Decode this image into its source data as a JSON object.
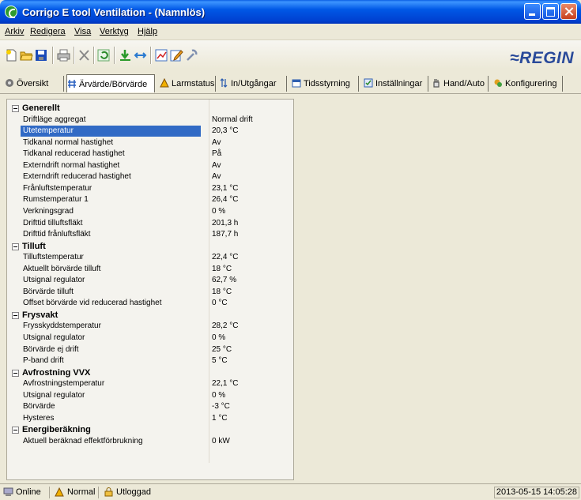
{
  "window": {
    "title": "Corrigo E tool Ventilation - (Namnlös)"
  },
  "menu": [
    "Arkiv",
    "Redigera",
    "Visa",
    "Verktyg",
    "Hjälp"
  ],
  "brand": {
    "logo_text": "≈REGIN",
    "color": "#2a4a9a"
  },
  "tabs": [
    {
      "label": "Översikt",
      "icon": "overview-icon"
    },
    {
      "label": "Ärvärde/Börvärde",
      "icon": "setpoint-icon",
      "active": true
    },
    {
      "label": "Larmstatus",
      "icon": "alarm-icon"
    },
    {
      "label": "In/Utgångar",
      "icon": "io-icon"
    },
    {
      "label": "Tidsstyrning",
      "icon": "calendar-icon"
    },
    {
      "label": "Inställningar",
      "icon": "settings-icon"
    },
    {
      "label": "Hand/Auto",
      "icon": "hand-icon"
    },
    {
      "label": "Konfigurering",
      "icon": "config-icon"
    }
  ],
  "groups": [
    {
      "name": "Generellt",
      "rows": [
        {
          "label": "Driftläge aggregat",
          "value": "Normal drift"
        },
        {
          "label": "Utetemperatur",
          "value": "20,3 °C",
          "selected": true
        },
        {
          "label": "Tidkanal normal hastighet",
          "value": "Av"
        },
        {
          "label": "Tidkanal reducerad hastighet",
          "value": "På"
        },
        {
          "label": "Externdrift normal hastighet",
          "value": "Av"
        },
        {
          "label": "Externdrift reducerad hastighet",
          "value": "Av"
        },
        {
          "label": "Frånluftstemperatur",
          "value": "23,1 °C"
        },
        {
          "label": "Rumstemperatur 1",
          "value": "26,4 °C"
        },
        {
          "label": "Verkningsgrad",
          "value": "0 %"
        },
        {
          "label": "Drifttid tilluftsfläkt",
          "value": "201,3 h"
        },
        {
          "label": "Drifttid frånluftsfläkt",
          "value": "187,7 h"
        }
      ]
    },
    {
      "name": "Tilluft",
      "rows": [
        {
          "label": "Tilluftstemperatur",
          "value": "22,4 °C"
        },
        {
          "label": "Aktuellt börvärde tilluft",
          "value": "18 °C"
        },
        {
          "label": "Utsignal regulator",
          "value": "62,7 %"
        },
        {
          "label": "Börvärde tilluft",
          "value": "18 °C"
        },
        {
          "label": "Offset börvärde vid reducerad hastighet",
          "value": "0 °C"
        }
      ]
    },
    {
      "name": "Frysvakt",
      "rows": [
        {
          "label": "Frysskyddstemperatur",
          "value": "28,2 °C"
        },
        {
          "label": "Utsignal regulator",
          "value": "0 %"
        },
        {
          "label": "Börvärde ej drift",
          "value": "25 °C"
        },
        {
          "label": "P-band drift",
          "value": "5 °C"
        }
      ]
    },
    {
      "name": "Avfrostning VVX",
      "rows": [
        {
          "label": "Avfrostningstemperatur",
          "value": "22,1 °C"
        },
        {
          "label": "Utsignal regulator",
          "value": "0 %"
        },
        {
          "label": "Börvärde",
          "value": "-3 °C"
        },
        {
          "label": "Hysteres",
          "value": "1 °C"
        }
      ]
    },
    {
      "name": "Energiberäkning",
      "rows": [
        {
          "label": "Aktuell beräknad effektförbrukning",
          "value": "0 kW"
        }
      ]
    }
  ],
  "status": {
    "connection": "Online",
    "alarm": "Normal",
    "user": "Utloggad",
    "datetime": "2013-05-15 14:05:28"
  },
  "colors": {
    "selection": "#316ac5",
    "titlebar": "#0058e6"
  }
}
